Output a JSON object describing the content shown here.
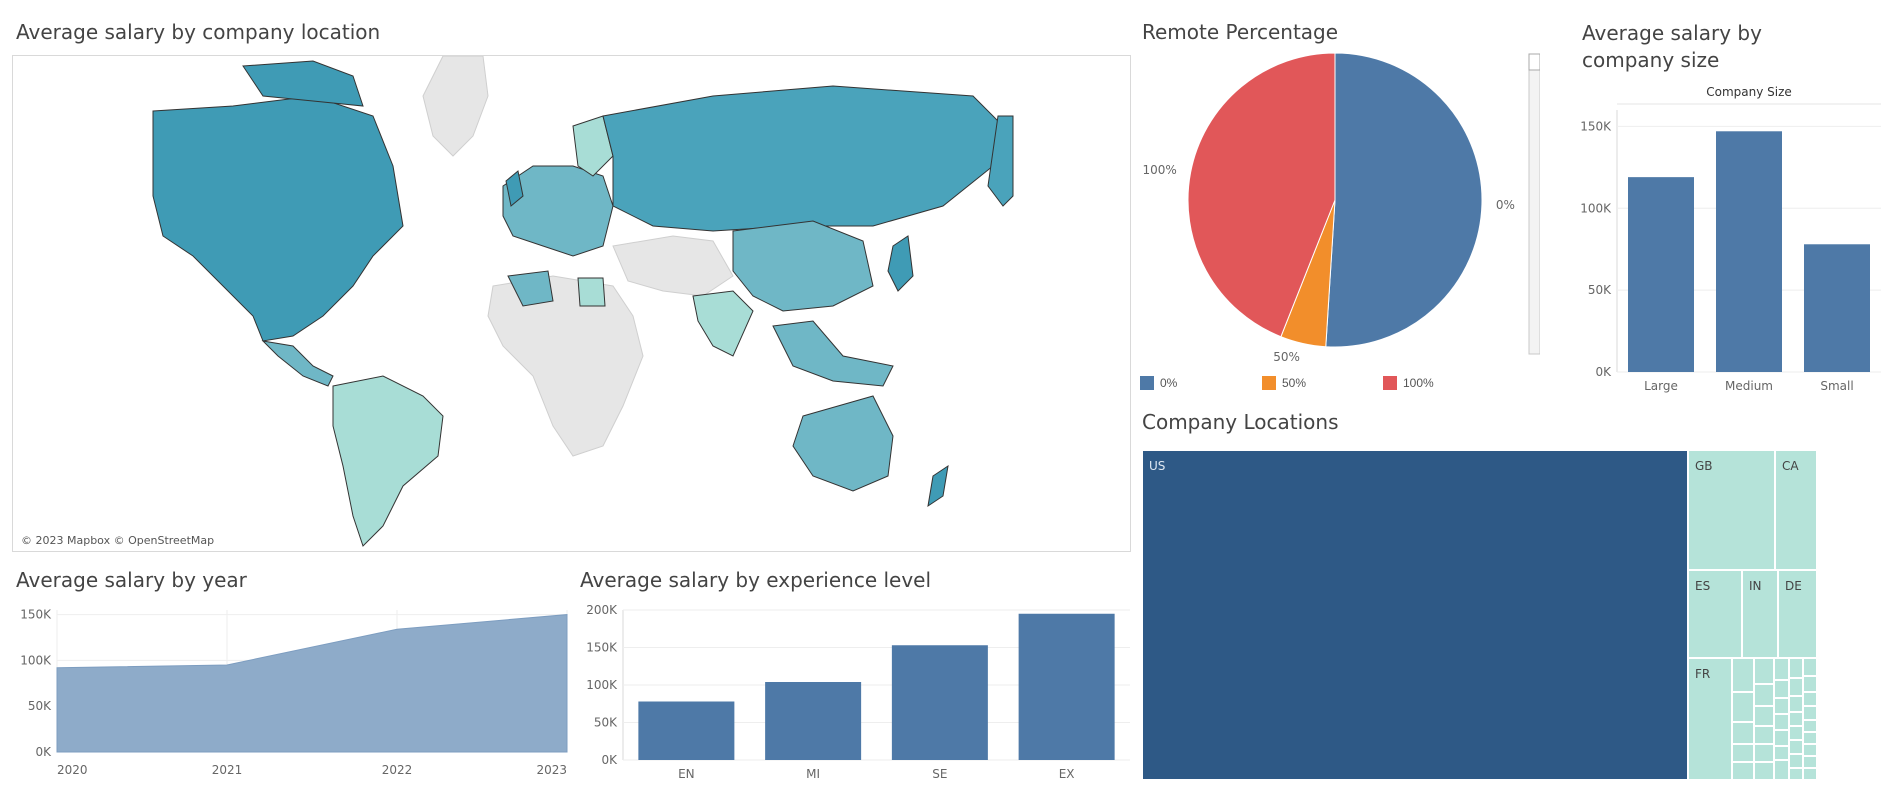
{
  "map": {
    "title": "Average salary by company location",
    "credit": "© 2023 Mapbox © OpenStreetMap",
    "colors": {
      "high": "#3f9bb5",
      "mid": "#6fb7c6",
      "low": "#a8ddd6",
      "none": "#e6e6e6"
    }
  },
  "remote": {
    "title": "Remote Percentage",
    "colors": {
      "0%": "#4e79a7",
      "50%": "#f28e2b",
      "100%": "#e15759"
    }
  },
  "company_size": {
    "title": "Average salary by company size",
    "header": "Company Size"
  },
  "locations": {
    "title": "Company Locations",
    "colors": {
      "us": "#2e5986",
      "other": "#b5e3d9"
    }
  },
  "by_year": {
    "title": "Average salary by year"
  },
  "by_experience": {
    "title": "Average salary by experience level"
  },
  "chart_data": [
    {
      "type": "map",
      "title": "Average salary by company location"
    },
    {
      "type": "pie",
      "title": "Remote Percentage",
      "categories": [
        "0%",
        "50%",
        "100%"
      ],
      "values": [
        51,
        5,
        44
      ],
      "legend": "bottom"
    },
    {
      "type": "bar",
      "title": "Average salary by company size",
      "xlabel": "Company Size",
      "categories": [
        "Large",
        "Medium",
        "Small"
      ],
      "values": [
        119000,
        147000,
        78000
      ],
      "yticks": [
        "0K",
        "50K",
        "100K",
        "150K"
      ],
      "ylim": [
        0,
        160000
      ],
      "grid": true
    },
    {
      "type": "treemap",
      "title": "Company Locations",
      "labels": [
        "US",
        "GB",
        "CA",
        "ES",
        "IN",
        "DE",
        "FR"
      ]
    },
    {
      "type": "area",
      "title": "Average salary by year",
      "x": [
        "2020",
        "2021",
        "2022",
        "2023"
      ],
      "values": [
        92000,
        95000,
        134000,
        150000
      ],
      "yticks": [
        "0K",
        "50K",
        "100K",
        "150K"
      ],
      "ylim": [
        0,
        155000
      ],
      "grid": true
    },
    {
      "type": "bar",
      "title": "Average salary by experience level",
      "categories": [
        "EN",
        "MI",
        "SE",
        "EX"
      ],
      "values": [
        78000,
        104000,
        153000,
        195000
      ],
      "yticks": [
        "0K",
        "50K",
        "100K",
        "150K",
        "200K"
      ],
      "ylim": [
        0,
        200000
      ],
      "grid": true
    }
  ]
}
